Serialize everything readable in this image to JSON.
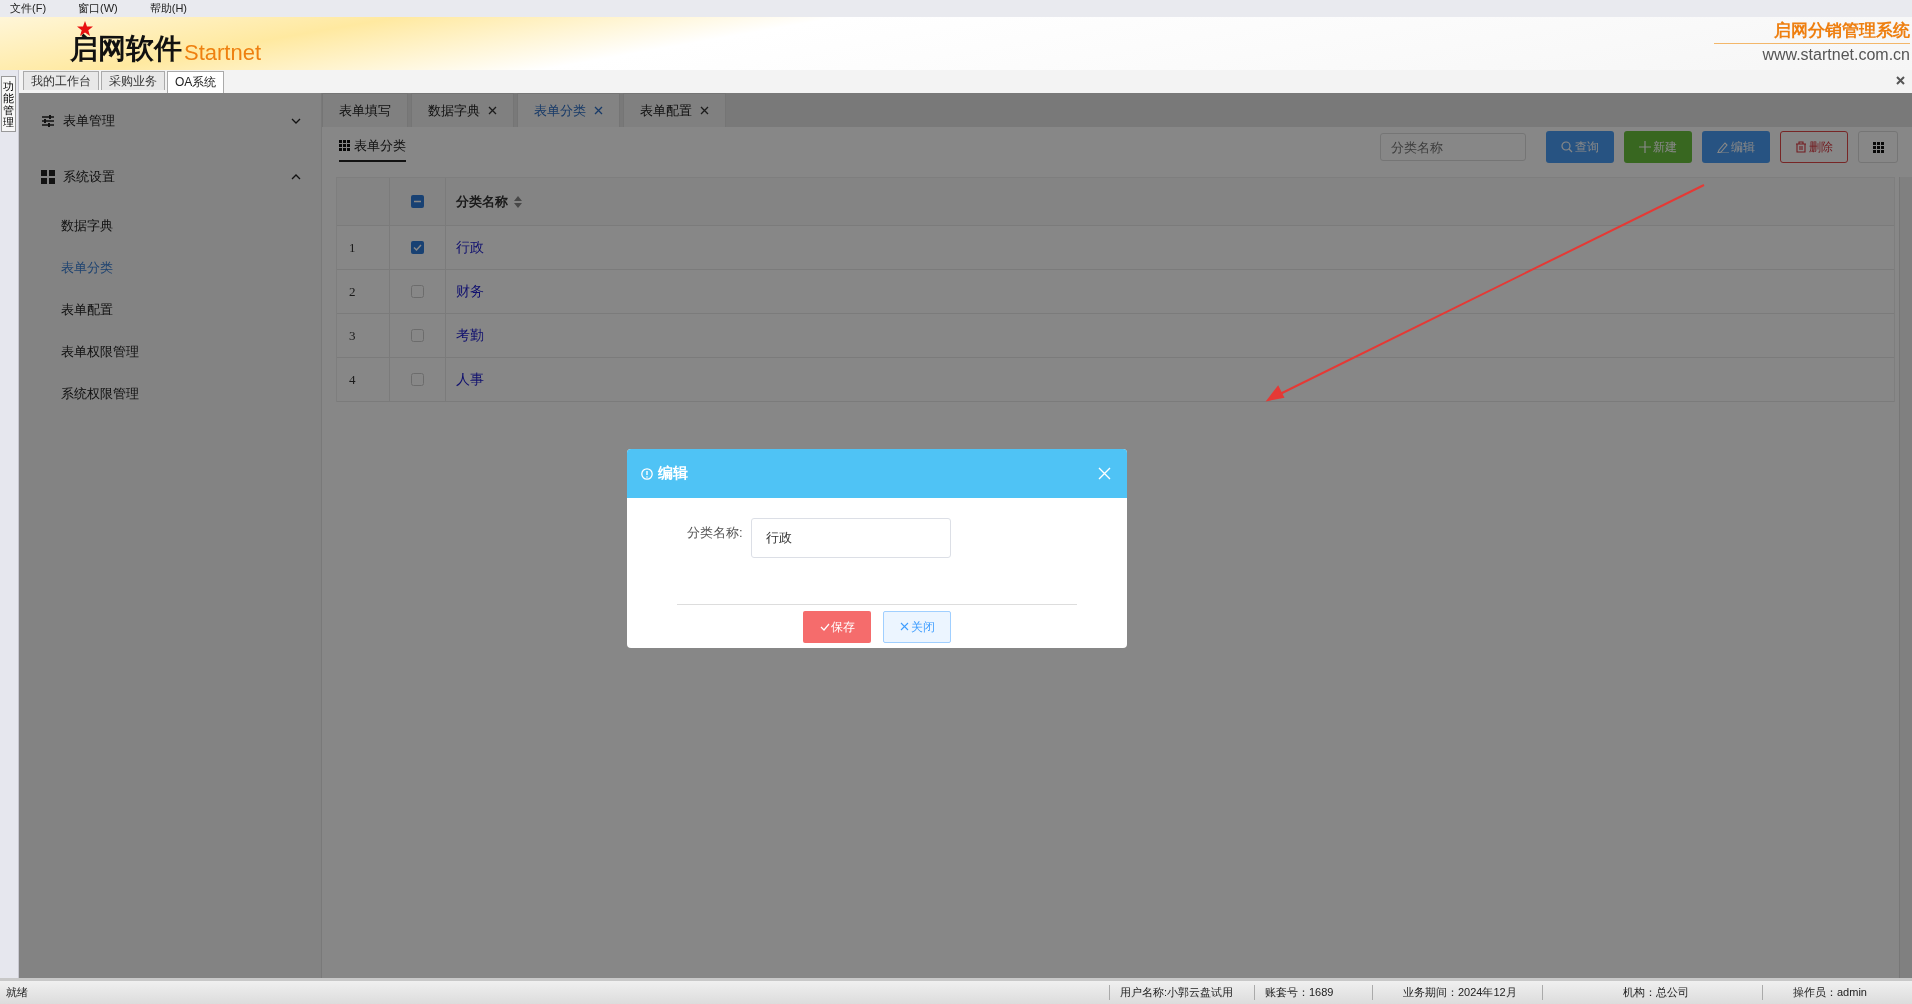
{
  "menu": [
    {
      "label": "文件(F)"
    },
    {
      "label": "窗口(W)"
    },
    {
      "label": "帮助(H)"
    }
  ],
  "header": {
    "logo": "启网软件",
    "logo_sub": "Startnet",
    "system_name": "启网分销管理系统",
    "website": "www.startnet.com.cn"
  },
  "side_strip": {
    "label": "功能管理"
  },
  "top_tabs": [
    {
      "label": "我的工作台",
      "selected": false
    },
    {
      "label": "采购业务",
      "selected": false
    },
    {
      "label": "OA系统",
      "selected": true
    }
  ],
  "sidebar": {
    "groups": [
      {
        "label": "表单管理",
        "expanded": false
      },
      {
        "label": "系统设置",
        "expanded": true,
        "children": [
          {
            "label": "数据字典",
            "selected": false
          },
          {
            "label": "表单分类",
            "selected": true
          },
          {
            "label": "表单配置",
            "selected": false
          },
          {
            "label": "表单权限管理",
            "selected": false
          },
          {
            "label": "系统权限管理",
            "selected": false
          }
        ]
      }
    ]
  },
  "content_tabs": [
    {
      "label": "表单填写",
      "closable": false,
      "selected": false
    },
    {
      "label": "数据字典",
      "closable": true,
      "selected": false
    },
    {
      "label": "表单分类",
      "closable": true,
      "selected": true
    },
    {
      "label": "表单配置",
      "closable": true,
      "selected": false
    }
  ],
  "toolbar": {
    "title": "表单分类",
    "search": {
      "placeholder": "分类名称"
    },
    "buttons": [
      {
        "kind": "query",
        "label": "查询"
      },
      {
        "kind": "new",
        "label": "新建"
      },
      {
        "kind": "edit",
        "label": "编辑"
      },
      {
        "kind": "delete",
        "label": "删除"
      },
      {
        "kind": "columns"
      }
    ]
  },
  "table": {
    "columns": [
      "分类名称"
    ],
    "header_indeterminate": true,
    "rows": [
      {
        "index": "1",
        "name": "行政",
        "checked": true
      },
      {
        "index": "2",
        "name": "财务",
        "checked": false
      },
      {
        "index": "3",
        "name": "考勤",
        "checked": false
      },
      {
        "index": "4",
        "name": "人事",
        "checked": false
      }
    ]
  },
  "dialog": {
    "title": "编辑",
    "field_label": "分类名称:",
    "field_value": "行政",
    "buttons": [
      {
        "kind": "save",
        "label": "保存"
      },
      {
        "kind": "close",
        "label": "关闭"
      }
    ]
  },
  "status_bar": [
    {
      "text": "就绪"
    },
    {
      "text": "用户名称:小郭云盘试用"
    },
    {
      "text": "账套号：1689"
    },
    {
      "text": "业务期间：2024年12月"
    },
    {
      "text": "机构：总公司"
    },
    {
      "text": "操作员：admin"
    }
  ]
}
